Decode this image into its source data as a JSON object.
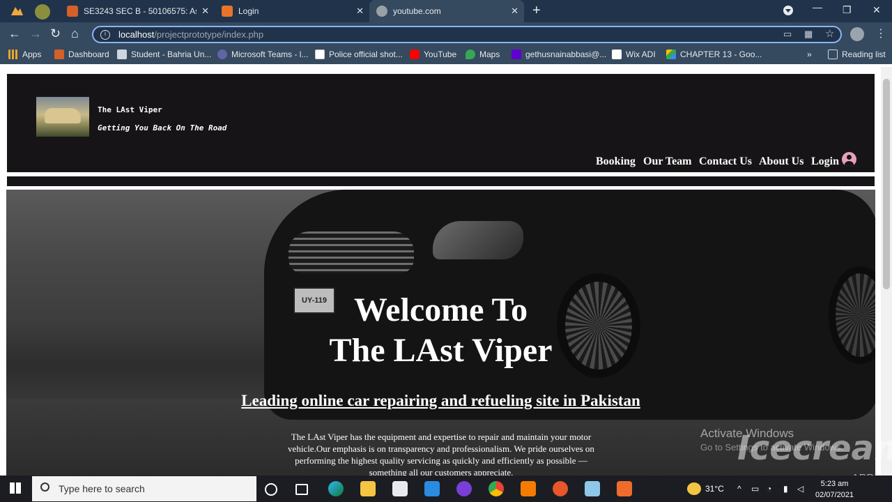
{
  "browser": {
    "tabs": [
      {
        "label": "SE3243 SEC B - 50106575: Assign",
        "active": false
      },
      {
        "label": "Login",
        "active": false
      },
      {
        "label": "youtube.com",
        "active": true
      }
    ],
    "url_host": "localhost",
    "url_path": "/projectprototype/index.php",
    "bookmarks": [
      "Apps",
      "Dashboard",
      "Student - Bahria Un...",
      "Microsoft Teams - l...",
      "Police official shot...",
      "YouTube",
      "Maps",
      "gethusnainabbasi@...",
      "Wix ADI",
      "CHAPTER 13 - Goo..."
    ],
    "reading_list": "Reading list",
    "more_bookmarks": "»"
  },
  "site": {
    "brand": "The LAst Viper",
    "tagline": "Getting You Back On The Road",
    "nav": [
      "Booking",
      "Our Team",
      "Contact Us",
      "About Us",
      "Login"
    ],
    "hero_title_1": "Welcome To",
    "hero_title_2": "The LAst Viper",
    "hero_subtitle": "Leading online car repairing and refueling site in Pakistan",
    "hero_paragraph": "The LAst Viper has the equipment and expertise to repair and maintain your motor vehicle.Our emphasis is on transparency and professionalism. We pride ourselves on performing the highest quality servicing as quickly and efficiently as possible — something all our customers appreciate.",
    "plate_text": "UY-119"
  },
  "watermarks": {
    "activate_title": "Activate Windows",
    "activate_sub": "Go to Settings to activate Windows.",
    "icecream": "Icecream",
    "apps": "APPS"
  },
  "taskbar": {
    "search_placeholder": "Type here to search",
    "temperature": "31°C",
    "time": "5:23 am",
    "date": "02/07/2021"
  },
  "colors": {
    "tab_strip": "#20334a",
    "toolbar": "#35495f",
    "site_header": "#161416",
    "omnibox_border": "#8ab4f8"
  }
}
